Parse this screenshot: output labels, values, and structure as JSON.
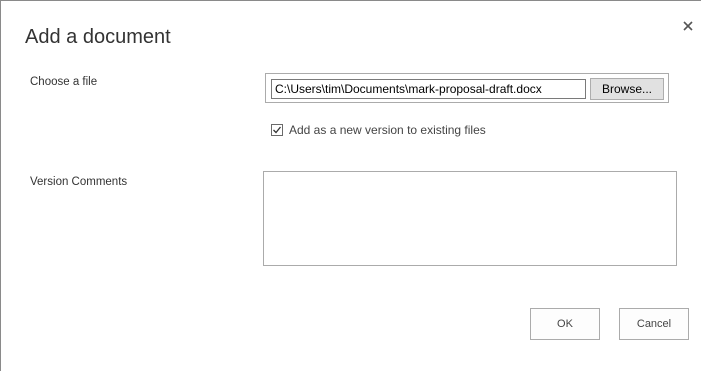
{
  "dialog": {
    "title": "Add a document",
    "close_icon": "close-icon"
  },
  "file": {
    "label": "Choose a file",
    "path_value": "C:\\Users\\tim\\Documents\\mark-proposal-draft.docx",
    "browse_label": "Browse..."
  },
  "version_option": {
    "checked": true,
    "label": "Add as a new version to existing files"
  },
  "comments": {
    "label": "Version Comments",
    "value": ""
  },
  "footer": {
    "ok_label": "OK",
    "cancel_label": "Cancel"
  }
}
